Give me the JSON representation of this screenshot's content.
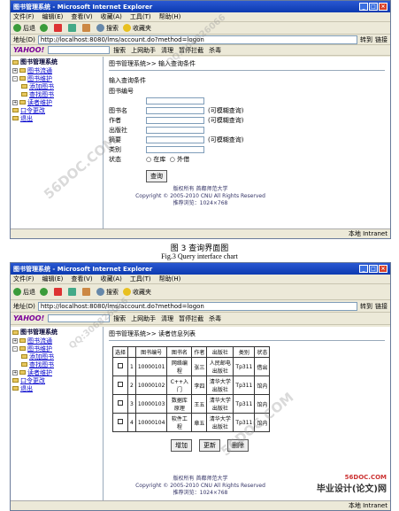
{
  "window": {
    "title": "图书管理系统 - Microsoft Internet Explorer",
    "menu": [
      "文件(F)",
      "编辑(E)",
      "查看(V)",
      "收藏(A)",
      "工具(T)",
      "帮助(H)"
    ],
    "toolbar": {
      "back": "后退",
      "search": "搜索",
      "favorites": "收藏夹"
    },
    "address_label": "地址(D)",
    "url": "http://localhost:8080/lms/account.do?method=logon",
    "go": "转到",
    "links": "链接",
    "yahoo": {
      "logo": "YAHOO!",
      "search_btn": "搜索",
      "assist": "上网助手",
      "clean": "清理",
      "block": "暂停拦截",
      "kill": "杀毒"
    }
  },
  "sidebar": {
    "root": "图书管理系统",
    "items": [
      {
        "label": "图书流通",
        "level": 1
      },
      {
        "label": "图书维护",
        "level": 1
      },
      {
        "label": "添加图书",
        "level": 2
      },
      {
        "label": "查找图书",
        "level": 2
      },
      {
        "label": "读者维护",
        "level": 1
      },
      {
        "label": "口令更改",
        "level": 1
      },
      {
        "label": "退出",
        "level": 1
      }
    ]
  },
  "screen1": {
    "breadcrumb": "图书管理系统>> 输入查询条件",
    "form_title": "输入查询条件",
    "fields": [
      {
        "label": "图书编号",
        "hint": ""
      },
      {
        "label": "图书名",
        "hint": "(可模糊查询)"
      },
      {
        "label": "作者",
        "hint": "(可模糊查询)"
      },
      {
        "label": "出版社",
        "hint": ""
      },
      {
        "label": "摘要",
        "hint": "(可模糊查询)"
      },
      {
        "label": "类别",
        "hint": ""
      }
    ],
    "status_label": "状态",
    "status_options": [
      "在库",
      "外借"
    ],
    "query_btn": "查询",
    "footer": [
      "版权所有 首都师范大学",
      "Copyright © 2005-2010 CNU All Rights Reserved",
      "推荐浏览：1024×768"
    ],
    "statusbar": "本地 Intranet"
  },
  "caption": {
    "cn": "图 3  查询界面图",
    "en": "Fig.3 Query interface chart"
  },
  "screen2": {
    "breadcrumb": "图书管理系统>> 读者信息列表",
    "columns": [
      "选择",
      "",
      "图书编号",
      "图书名",
      "作者",
      "出版社",
      "类别",
      "状态"
    ],
    "rows": [
      [
        "1",
        "10000101",
        "网络编程",
        "张三",
        "人民邮电出版社",
        "Tp311",
        "借出"
      ],
      [
        "2",
        "10000102",
        "C++入门",
        "李四",
        "清华大学出版社",
        "Tp311",
        "馆内"
      ],
      [
        "3",
        "10000103",
        "数据库原理",
        "王五",
        "清华大学出版社",
        "Tp311",
        "馆内"
      ],
      [
        "4",
        "10000104",
        "软件工程",
        "章五",
        "清华大学出版社",
        "Tp311",
        "馆内"
      ]
    ],
    "buttons": [
      "增加",
      "更新",
      "删除"
    ],
    "footer": [
      "版权所有 首都师范大学",
      "Copyright © 2005-2010 CNU All Rights Reserved",
      "推荐浏览：1024×768"
    ],
    "statusbar": "本地 Intranet"
  },
  "watermarks": [
    "56DOC.COM",
    "QQ:306826066",
    "56DOC.COM",
    "QQ:306826066"
  ],
  "brand": "毕业设计(论文)网",
  "brand_site": "56DOC.COM"
}
